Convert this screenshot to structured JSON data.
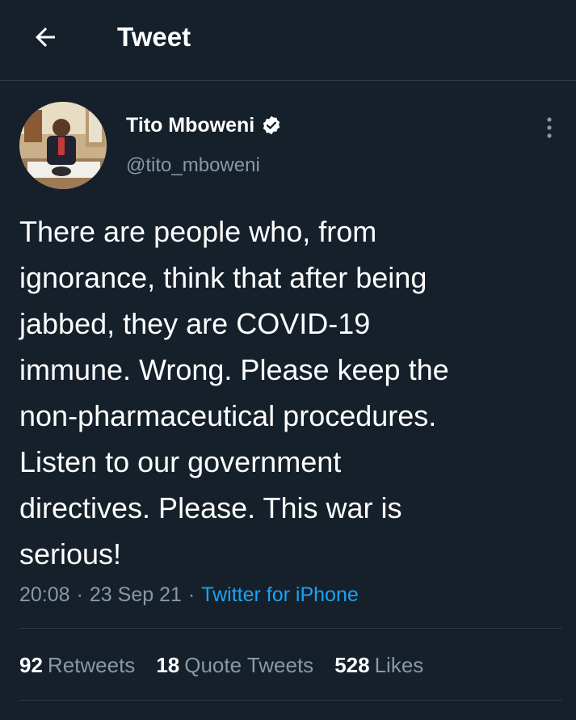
{
  "header": {
    "back_icon": "arrow-left-icon",
    "title": "Tweet"
  },
  "author": {
    "name": "Tito Mboweni",
    "handle": "@tito_mboweni",
    "verified": true,
    "verified_icon": "verified-badge-icon",
    "avatar": "profile-photo"
  },
  "more_icon": "more-vertical-icon",
  "tweet": {
    "text": "There are people who, from\nignorance, think that after being\njabbed, they are COVID-19\nimmune. Wrong. Please keep the\nnon-pharmaceutical procedures.\nListen to our government\ndirectives. Please. This war is\nserious!",
    "time": "20:08",
    "date": "23 Sep 21",
    "source": "Twitter for iPhone"
  },
  "stats": {
    "retweets_count": "92",
    "retweets_label": "Retweets",
    "quotes_count": "18",
    "quotes_label": "Quote Tweets",
    "likes_count": "528",
    "likes_label": "Likes"
  },
  "colors": {
    "background": "#15202b",
    "accent": "#1da1f2",
    "muted": "#8899a6",
    "border": "#2f3b47"
  }
}
